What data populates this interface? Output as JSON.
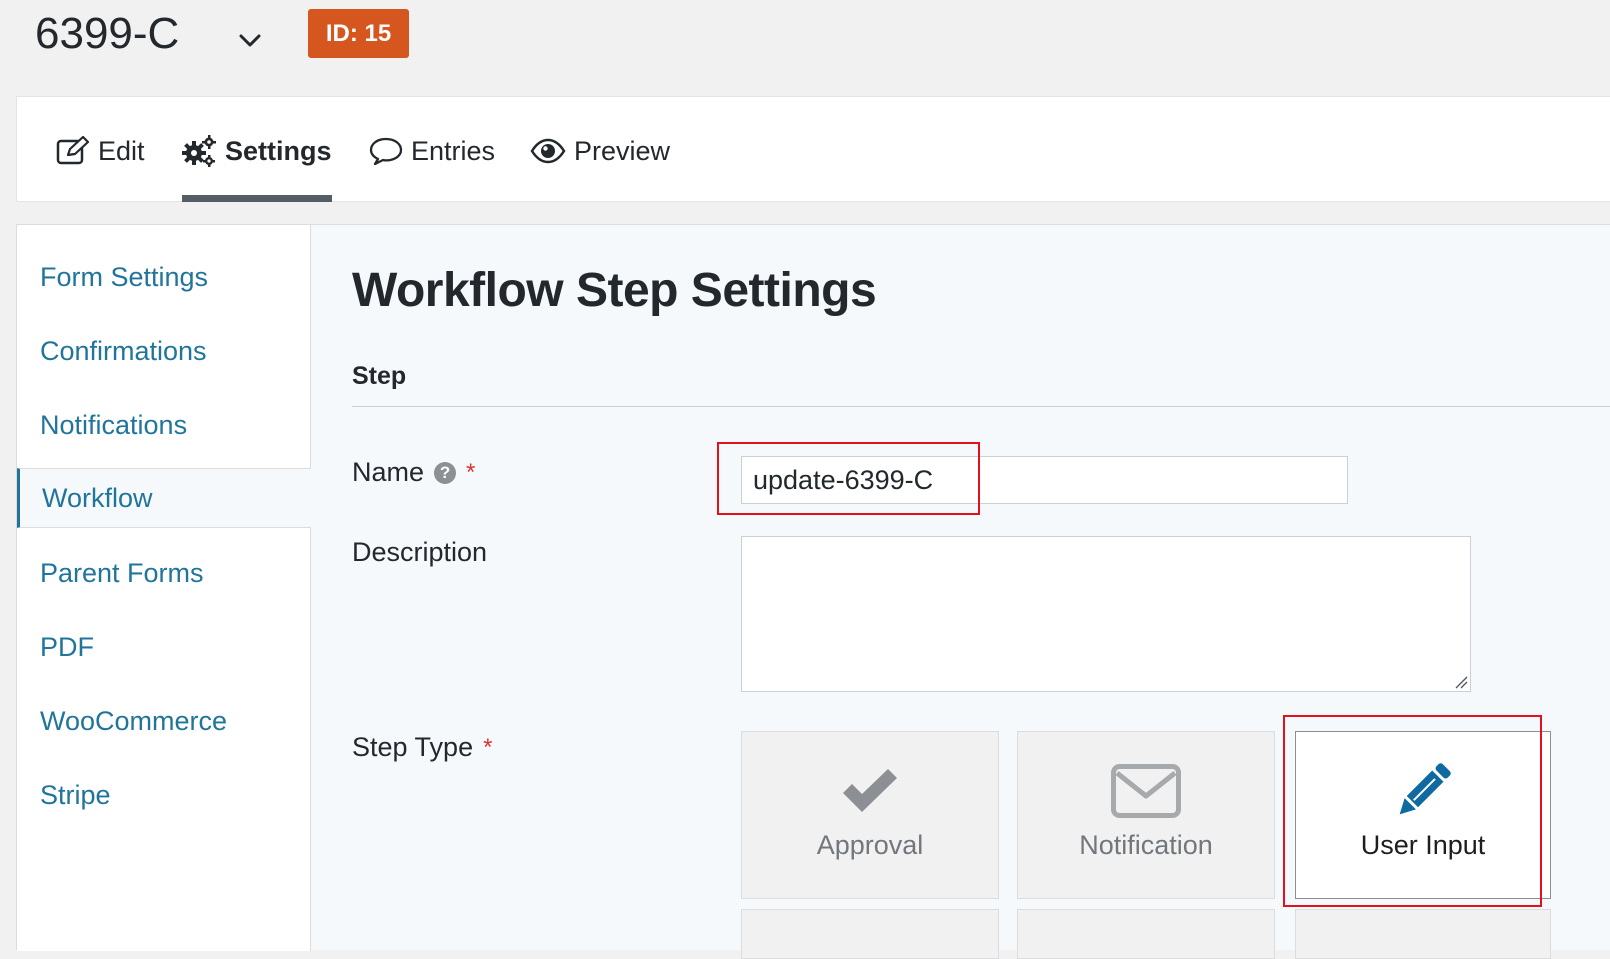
{
  "header": {
    "form_title": "6399-C",
    "id_badge": "ID: 15"
  },
  "tabs": [
    {
      "label": "Edit",
      "icon": "edit-icon"
    },
    {
      "label": "Settings",
      "icon": "gears-icon",
      "active": true
    },
    {
      "label": "Entries",
      "icon": "speech-bubble-icon"
    },
    {
      "label": "Preview",
      "icon": "eye-icon"
    }
  ],
  "sidebar": {
    "items": [
      {
        "label": "Form Settings"
      },
      {
        "label": "Confirmations"
      },
      {
        "label": "Notifications"
      },
      {
        "label": "Workflow",
        "active": true
      },
      {
        "label": "Parent Forms"
      },
      {
        "label": "PDF"
      },
      {
        "label": "WooCommerce"
      },
      {
        "label": "Stripe"
      }
    ]
  },
  "main": {
    "title": "Workflow Step Settings",
    "section": "Step",
    "fields": {
      "name": {
        "label": "Name",
        "value": "update-6399-C",
        "required_mark": "*"
      },
      "description": {
        "label": "Description",
        "value": ""
      },
      "step_type": {
        "label": "Step Type",
        "required_mark": "*"
      }
    },
    "step_types": [
      {
        "label": "Approval",
        "icon": "checkmark-icon"
      },
      {
        "label": "Notification",
        "icon": "envelope-icon"
      },
      {
        "label": "User Input",
        "icon": "pencil-icon",
        "selected": true
      }
    ]
  },
  "colors": {
    "accent": "#21759b",
    "badge": "#d6561f",
    "required": "#dc3232",
    "highlight": "#e3111b"
  }
}
